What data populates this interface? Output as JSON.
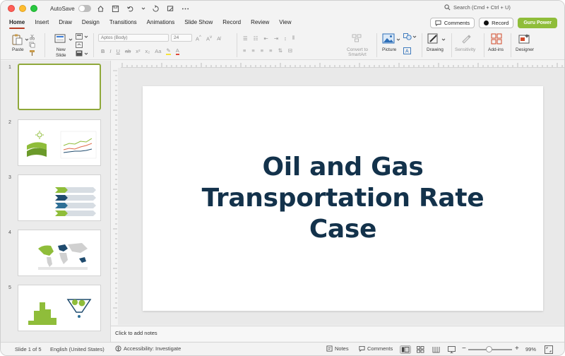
{
  "window": {
    "autosave_label": "AutoSave",
    "search_placeholder": "Search (Cmd + Ctrl + U)"
  },
  "tabs": [
    {
      "label": "Home",
      "active": true
    },
    {
      "label": "Insert"
    },
    {
      "label": "Draw"
    },
    {
      "label": "Design"
    },
    {
      "label": "Transitions"
    },
    {
      "label": "Animations"
    },
    {
      "label": "Slide Show"
    },
    {
      "label": "Record"
    },
    {
      "label": "Review"
    },
    {
      "label": "View"
    }
  ],
  "tab_actions": {
    "comments": "Comments",
    "record": "Record",
    "guru": "Guru Power"
  },
  "ribbon": {
    "paste": "Paste",
    "new_slide": "New\nSlide",
    "font_name": "Aptos (Body)",
    "font_size": "24",
    "convert_smartart": "Convert to\nSmartArt",
    "picture": "Picture",
    "drawing": "Drawing",
    "sensitivity": "Sensitivity",
    "addins": "Add-ins",
    "designer": "Designer"
  },
  "thumbnails": [
    {
      "number": "1",
      "active": true
    },
    {
      "number": "2"
    },
    {
      "number": "3"
    },
    {
      "number": "4"
    },
    {
      "number": "5"
    }
  ],
  "slide": {
    "title_lines": [
      "Oil and Gas",
      "Transportation Rate",
      "Case"
    ]
  },
  "notes_placeholder": "Click to add notes",
  "status": {
    "slide_of": "Slide 1 of 5",
    "language": "English (United States)",
    "accessibility": "Accessibility: Investigate",
    "notes": "Notes",
    "comments": "Comments",
    "zoom": "99%"
  },
  "colors": {
    "accent_tab_underline": "#b83c24",
    "guru_button": "#8fbd3a",
    "title_text": "#13324b",
    "thumb_highlight": "#8fa83a"
  }
}
